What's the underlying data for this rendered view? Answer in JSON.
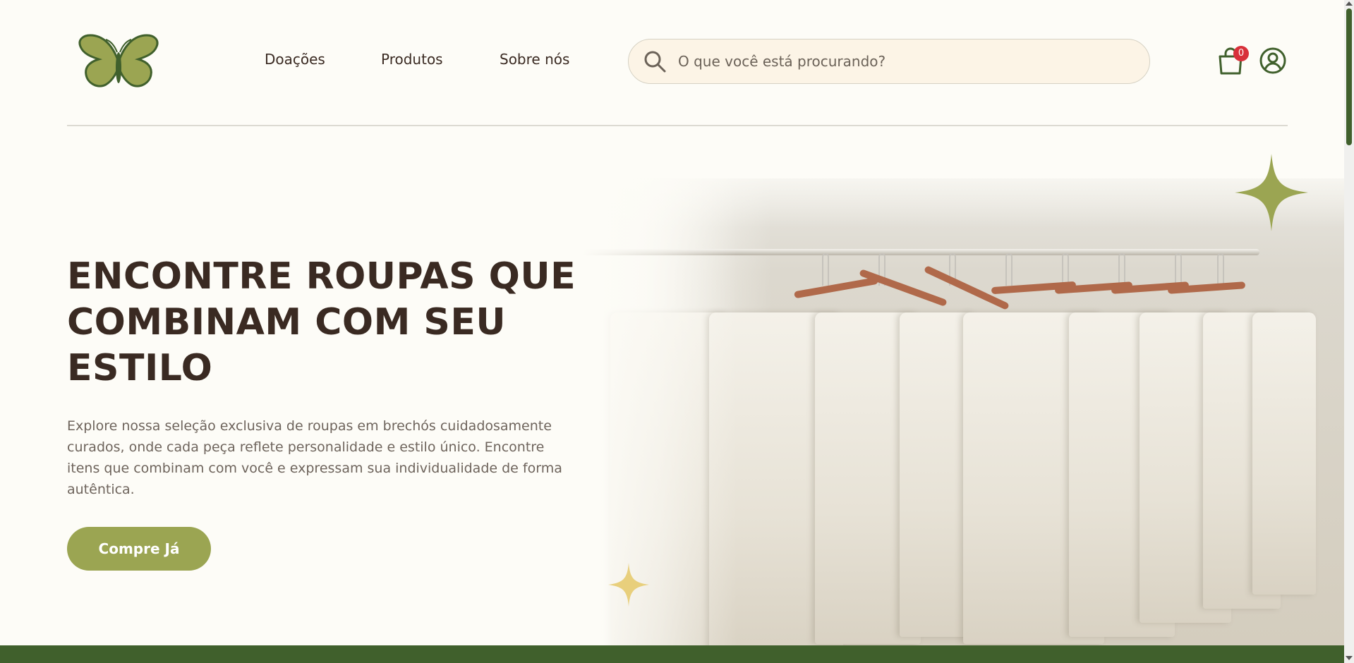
{
  "header": {
    "nav": [
      {
        "label": "Doações"
      },
      {
        "label": "Produtos"
      },
      {
        "label": "Sobre nós"
      }
    ],
    "search": {
      "placeholder": "O que você está procurando?",
      "icon": "search-icon"
    },
    "cart": {
      "icon": "shopping-bag-icon",
      "count": "0"
    },
    "user": {
      "icon": "user-circle-icon"
    },
    "logo": {
      "icon": "butterfly-logo"
    }
  },
  "hero": {
    "headline": "ENCONTRE ROUPAS QUE COMBINAM COM SEU ESTILO",
    "description": "Explore nossa seleção exclusiva de roupas em brechós cuidadosamente curados, onde cada peça reflete personalidade e estilo único. Encontre itens que combinam com você e expressam sua individualidade de forma autêntica.",
    "cta_label": "Compre Já"
  },
  "colors": {
    "brand_green": "#40602c",
    "olive": "#9ba552",
    "text_dark": "#3a2a22",
    "background": "#fdfcf7",
    "sparkle_yellow": "#e8cf7c",
    "badge_red": "#d8303a"
  }
}
